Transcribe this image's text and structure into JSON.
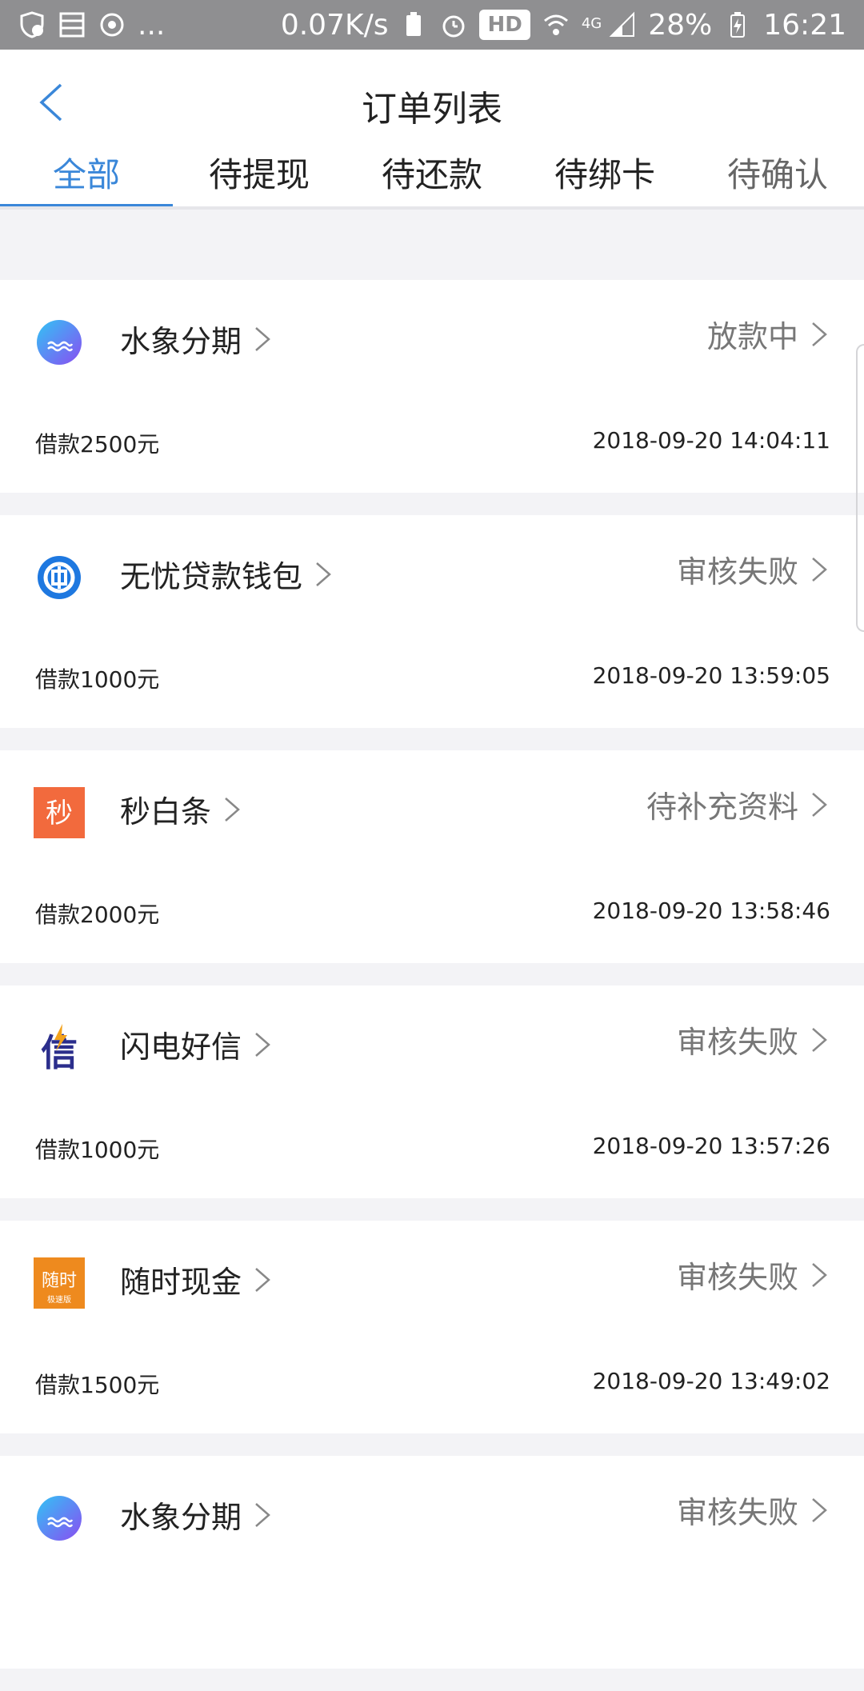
{
  "status_bar": {
    "left_more": "...",
    "net_speed": "0.07K/s",
    "hd": "HD",
    "network": "4G",
    "battery": "28%",
    "time": "16:21"
  },
  "header": {
    "title": "订单列表"
  },
  "tabs": [
    {
      "label": "全部",
      "active": true
    },
    {
      "label": "待提现"
    },
    {
      "label": "待还款"
    },
    {
      "label": "待绑卡"
    },
    {
      "label": "待确认"
    }
  ],
  "orders": [
    {
      "name": "水象分期",
      "status": "放款中",
      "amount": "借款2500元",
      "time": "2018-09-20 14:04:11",
      "logo": "water-logo-icon"
    },
    {
      "name": "无忧贷款钱包",
      "status": "审核失败",
      "amount": "借款1000元",
      "time": "2018-09-20 13:59:05",
      "logo": "wallet-logo-icon"
    },
    {
      "name": "秒白条",
      "status": "待补充资料",
      "amount": "借款2000元",
      "time": "2018-09-20 13:58:46",
      "logo": "miao-logo-icon",
      "logo_text": "秒"
    },
    {
      "name": "闪电好信",
      "status": "审核失败",
      "amount": "借款1000元",
      "time": "2018-09-20 13:57:26",
      "logo": "xin-logo-icon",
      "logo_text": "信"
    },
    {
      "name": "随时现金",
      "status": "审核失败",
      "amount": "借款1500元",
      "time": "2018-09-20 13:49:02",
      "logo": "suishi-logo-icon",
      "logo_text": "随时",
      "logo_sub": "极速版"
    },
    {
      "name": "水象分期",
      "status": "审核失败",
      "amount": "",
      "time": "",
      "logo": "water-logo-icon"
    }
  ],
  "colors": {
    "accent": "#3a87d9",
    "status_bar": "#8f8f91",
    "background": "#f3f3f6"
  }
}
